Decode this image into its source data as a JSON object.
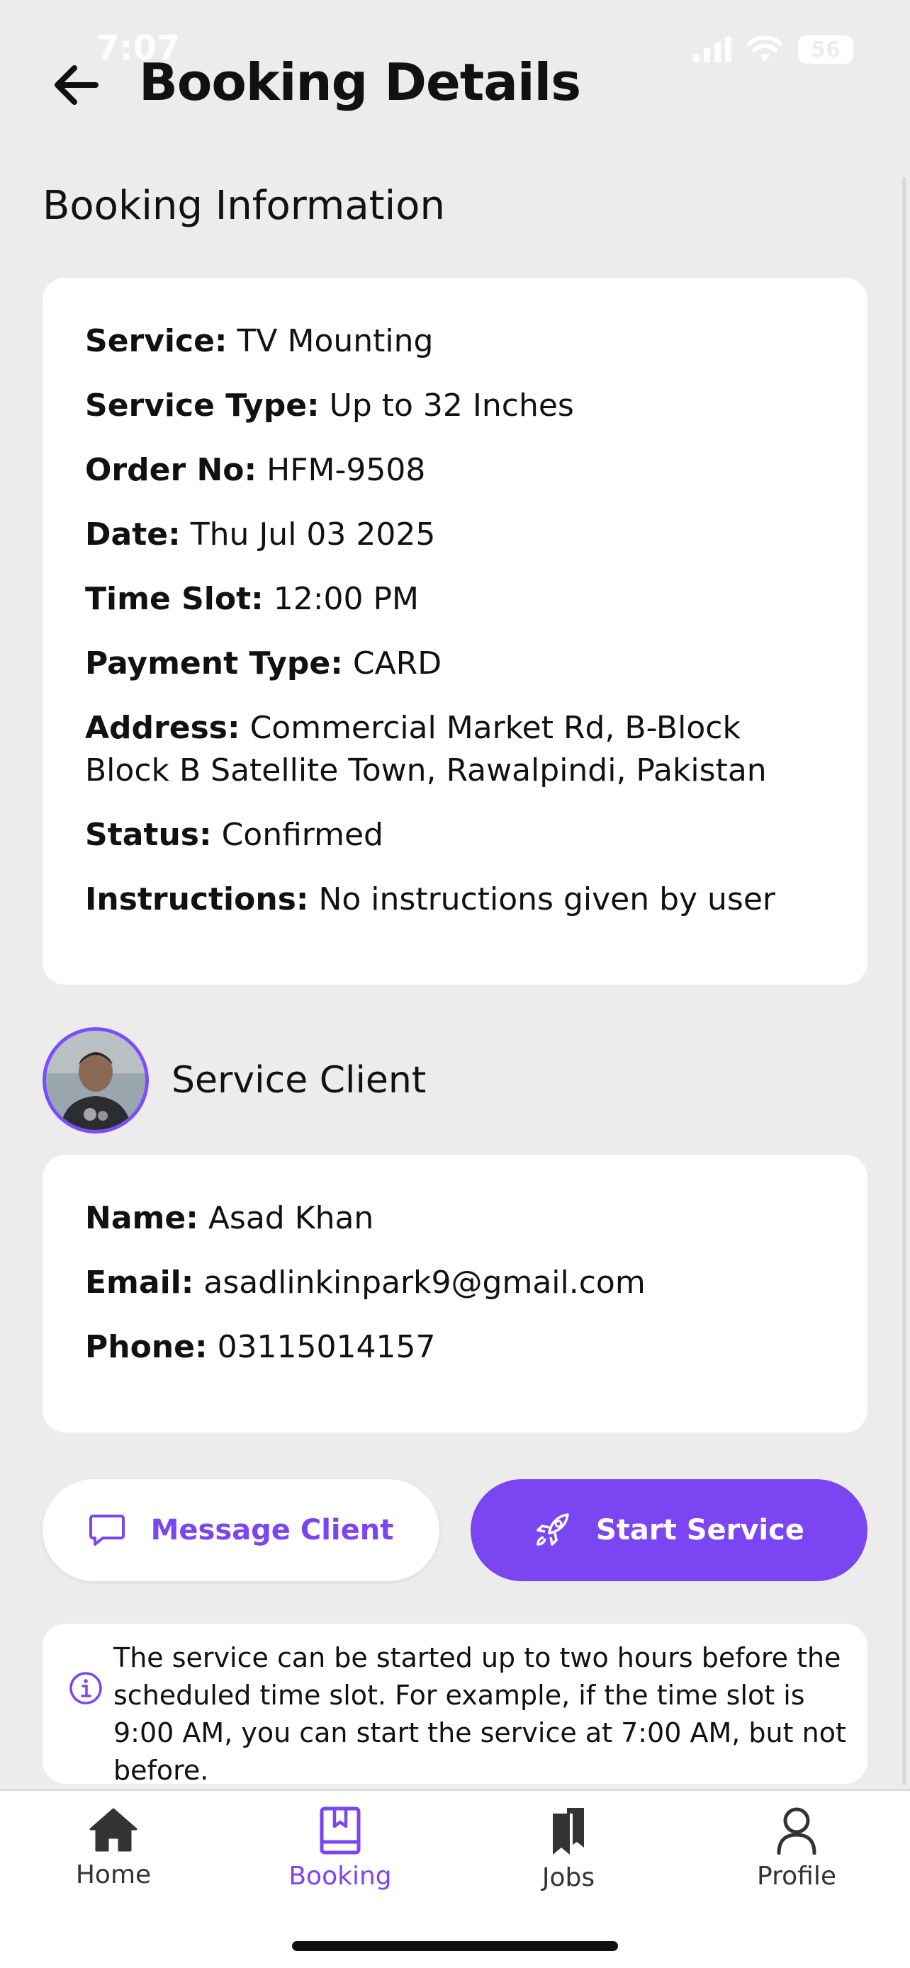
{
  "status_bar": {
    "time": "7:07",
    "battery": "56"
  },
  "header": {
    "title": "Booking Details"
  },
  "booking": {
    "section_title": "Booking Information",
    "rows": [
      {
        "label": "Service:",
        "value": "TV Mounting"
      },
      {
        "label": "Service Type:",
        "value": "Up to 32 Inches"
      },
      {
        "label": "Order No:",
        "value": "HFM-9508"
      },
      {
        "label": "Date:",
        "value": "Thu Jul 03 2025"
      },
      {
        "label": "Time Slot:",
        "value": "12:00 PM"
      },
      {
        "label": "Payment Type:",
        "value": "CARD"
      },
      {
        "label": "Address:",
        "value": "Commercial Market Rd, B-Block Block B Satellite Town, Rawalpindi, Pakistan"
      },
      {
        "label": "Status:",
        "value": "Confirmed"
      },
      {
        "label": "Instructions:",
        "value": "No instructions given by user"
      }
    ]
  },
  "client": {
    "heading": "Service Client",
    "rows": [
      {
        "label": "Name:",
        "value": "Asad Khan"
      },
      {
        "label": "Email:",
        "value": "asadlinkinpark9@gmail.com"
      },
      {
        "label": "Phone:",
        "value": "03115014157"
      }
    ]
  },
  "actions": {
    "message_label": "Message Client",
    "start_label": "Start Service"
  },
  "note": {
    "text": "The service can be started up to two hours before the scheduled time slot. For example, if the time slot is 9:00 AM, you can start the service at 7:00 AM, but not before."
  },
  "tabs": [
    {
      "label": "Home",
      "icon": "home-icon"
    },
    {
      "label": "Booking",
      "icon": "book-icon",
      "active": true
    },
    {
      "label": "Jobs",
      "icon": "bookmarks-icon"
    },
    {
      "label": "Profile",
      "icon": "person-icon"
    }
  ],
  "colors": {
    "accent": "#7b45f2",
    "background": "#ececec",
    "card": "#ffffff"
  }
}
